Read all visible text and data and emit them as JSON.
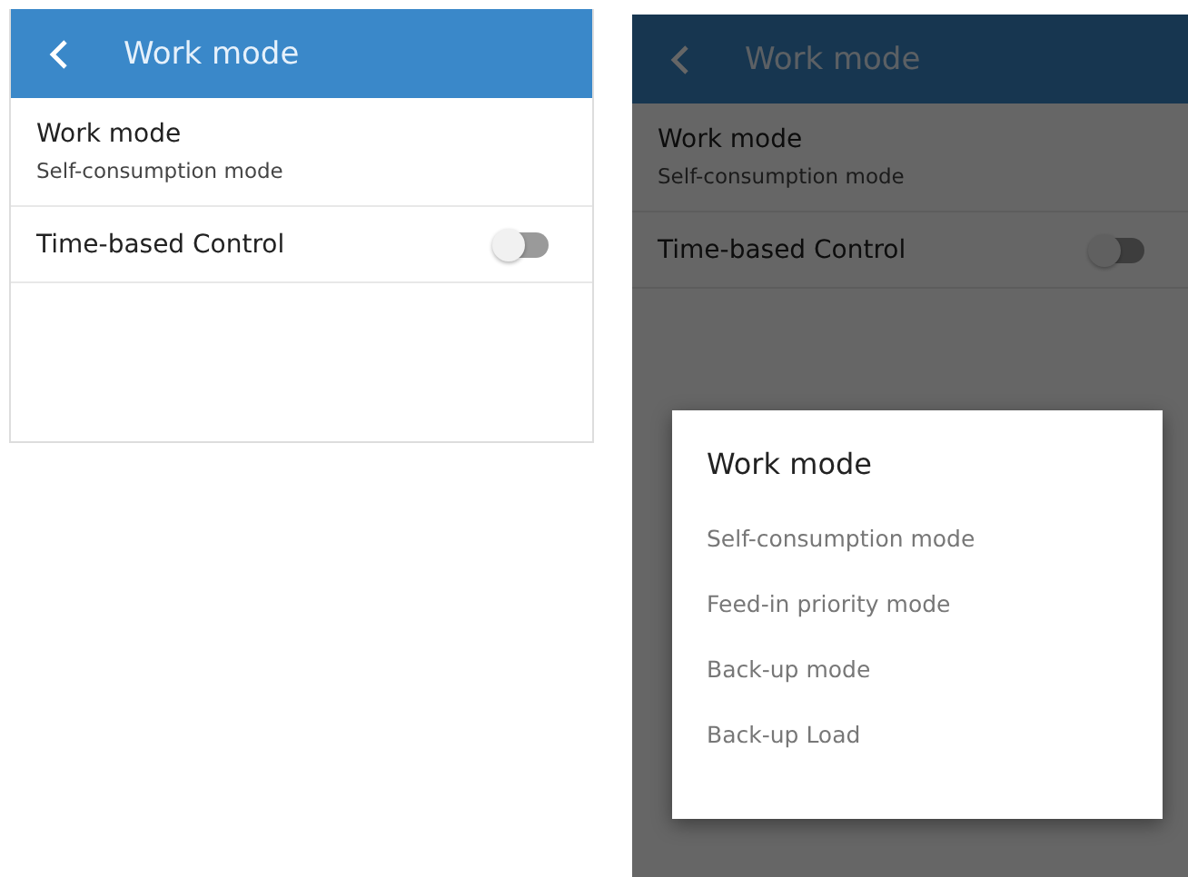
{
  "screens": [
    {
      "title": "Work mode",
      "dimmed": false,
      "settings": [
        {
          "kind": "value",
          "label": "Work mode",
          "value": "Self-consumption mode"
        },
        {
          "kind": "toggle",
          "label": "Time-based Control",
          "on": false
        }
      ]
    },
    {
      "title": "Work mode",
      "dimmed": true,
      "settings": [
        {
          "kind": "value",
          "label": "Work mode",
          "value": "Self-consumption mode"
        },
        {
          "kind": "toggle",
          "label": "Time-based Control",
          "on": false
        }
      ],
      "dialog": {
        "title": "Work mode",
        "options": [
          "Self-consumption mode",
          "Feed-in priority mode",
          "Back-up mode",
          "Back-up Load"
        ]
      }
    }
  ]
}
